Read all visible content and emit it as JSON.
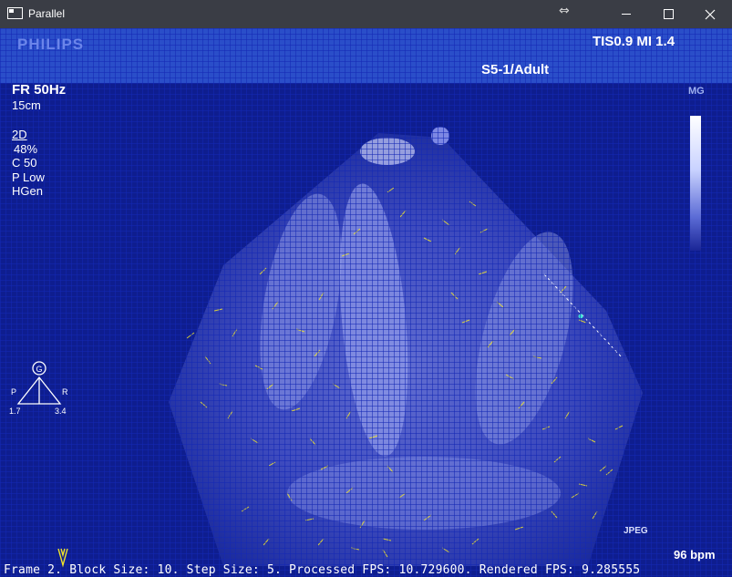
{
  "window": {
    "title": "Parallel",
    "resize_icon": "⇔"
  },
  "header": {
    "brand": "PHILIPS",
    "tis_mi": "TIS0.9   MI 1.4",
    "probe": "S5-1/Adult"
  },
  "imaging": {
    "frame_rate": "FR 50Hz",
    "depth": "15cm",
    "mode": "2D",
    "gain": "48%",
    "compress": "C 50",
    "power": "P Low",
    "harmonic": "HGen",
    "colorbar_label": "MG",
    "compression_tag": "JPEG",
    "heart_rate": "96 bpm"
  },
  "orientation": {
    "left_label": "P",
    "right_label": "R",
    "left_value": "1.7",
    "right_value": "3.4",
    "marker": "G"
  },
  "status_line": "Frame 2. Block Size: 10. Step Size: 5. Processed FPS: 10.729600. Rendered FPS: 9.285555"
}
